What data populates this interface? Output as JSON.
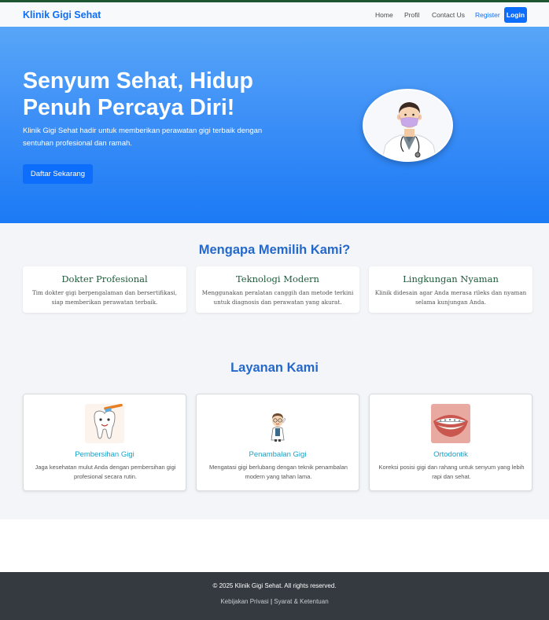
{
  "nav": {
    "brand": "Klinik Gigi Sehat",
    "home": "Home",
    "profil": "Profil",
    "contact": "Contact Us",
    "register": "Register",
    "login": "Login"
  },
  "hero": {
    "title": "Senyum Sehat, Hidup Penuh Percaya Diri!",
    "subtitle": "Klinik Gigi Sehat hadir untuk memberikan perawatan gigi terbaik dengan sentuhan profesional dan ramah.",
    "cta": "Daftar Sekarang"
  },
  "why": {
    "title": "Mengapa Memilih Kami?",
    "items": [
      {
        "title": "Dokter Profesional",
        "desc": "Tim dokter gigi berpengalaman dan bersertifikasi, siap memberikan perawatan terbaik."
      },
      {
        "title": "Teknologi Modern",
        "desc": "Menggunakan peralatan canggih dan metode terkini untuk diagnosis dan perawatan yang akurat."
      },
      {
        "title": "Lingkungan Nyaman",
        "desc": "Klinik didesain agar Anda merasa rileks dan nyaman selama kunjungan Anda."
      }
    ]
  },
  "services": {
    "title": "Layanan Kami",
    "items": [
      {
        "title": "Pembersihan Gigi",
        "desc": "Jaga kesehatan mulut Anda dengan pembersihan gigi profesional secara rutin.",
        "icon": "tooth-brushing-image"
      },
      {
        "title": "Penambalan Gigi",
        "desc": "Mengatasi gigi berlubang dengan teknik penambalan modern yang tahan lama.",
        "icon": "dentist-cartoon-image"
      },
      {
        "title": "Ortodontik",
        "desc": "Koreksi posisi gigi dan rahang untuk senyum yang lebih rapi dan sehat.",
        "icon": "braces-smile-image"
      }
    ]
  },
  "footer": {
    "copyright": "© 2025 Klinik Gigi Sehat. All rights reserved.",
    "privacy": "Kebijakan Privasi",
    "separator": "|",
    "terms": "Syarat & Ketentuan"
  },
  "colors": {
    "primary": "#0d6efd",
    "heading_blue": "#2468cc",
    "feature_green": "#1f5c3a",
    "service_cyan": "#17a2c8",
    "footer_bg": "#343a40"
  }
}
